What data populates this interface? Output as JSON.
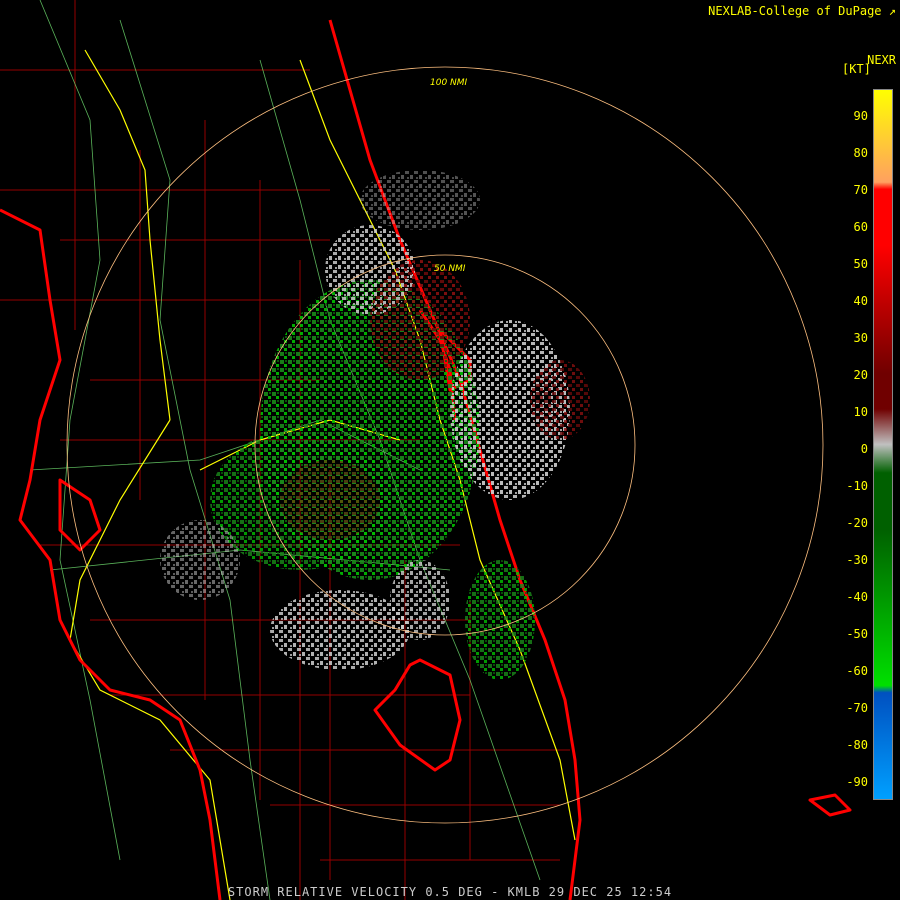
{
  "header": {
    "credit": "NEXLAB-College of DuPage",
    "product": "NEXR",
    "units": "[KT]"
  },
  "range_rings": [
    {
      "label": "100 NMI"
    },
    {
      "label": "50 NMI"
    }
  ],
  "legend": {
    "ticks": [
      "90",
      "80",
      "70",
      "60",
      "50",
      "40",
      "30",
      "20",
      "10",
      "0",
      "-10",
      "-20",
      "-30",
      "-40",
      "-50",
      "-60",
      "-70",
      "-80",
      "-90"
    ],
    "colors": {
      "yellow": "#ffff00",
      "orange": "#ffa060",
      "red": "#ff0000",
      "dark_red": "#700000",
      "gray": "#c0c0c0",
      "dark_green": "#006000",
      "green": "#00e000",
      "blue": "#0050c0",
      "cyan": "#00a0ff"
    }
  },
  "footer": {
    "caption": "STORM RELATIVE VELOCITY 0.5 DEG - KMLB 29 DEC 25 12:54"
  },
  "colors": {
    "county_lines": "#c00000",
    "coast": "#ff0000",
    "highways": "#ffff00",
    "roads": "#80ff80",
    "rings": "#ffc080"
  }
}
